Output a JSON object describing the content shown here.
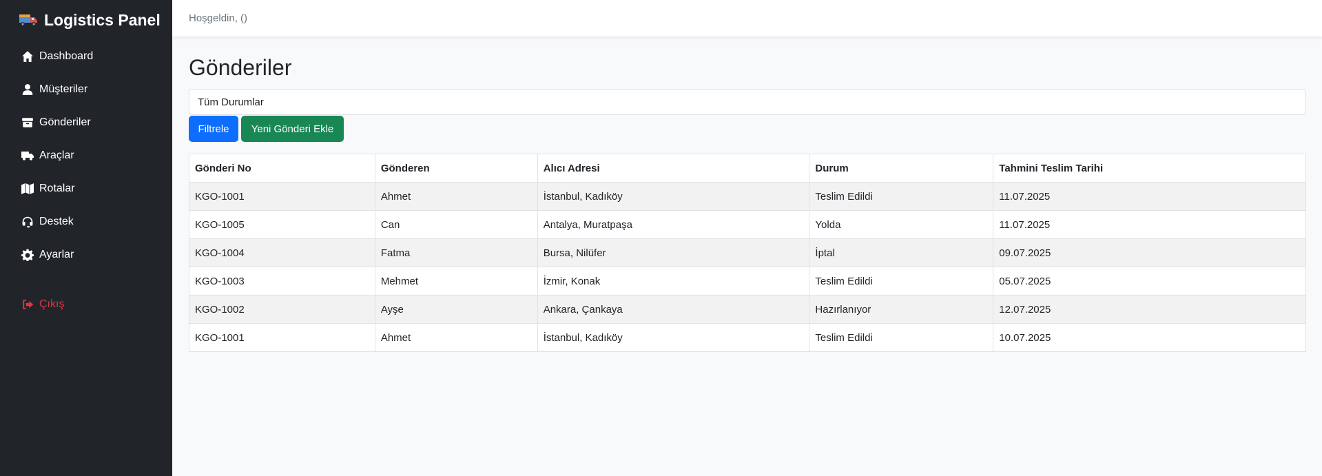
{
  "sidebar": {
    "brand": "Logistics Panel",
    "brand_icon": "truck-icon",
    "items": [
      {
        "label": "Dashboard",
        "icon": "home-icon"
      },
      {
        "label": "Müşteriler",
        "icon": "user-icon"
      },
      {
        "label": "Gönderiler",
        "icon": "box-icon"
      },
      {
        "label": "Araçlar",
        "icon": "truck-icon"
      },
      {
        "label": "Rotalar",
        "icon": "map-icon"
      },
      {
        "label": "Destek",
        "icon": "headset-icon"
      },
      {
        "label": "Ayarlar",
        "icon": "gear-icon"
      }
    ],
    "logout": {
      "label": "Çıkış",
      "icon": "logout-icon",
      "color": "#dc3545"
    }
  },
  "topbar": {
    "greeting": "Hoşgeldin, ()"
  },
  "main": {
    "title": "Gönderiler",
    "filter_select": "Tüm Durumlar",
    "filter_button": "Filtrele",
    "add_button": "Yeni Gönderi Ekle"
  },
  "table": {
    "headers": [
      "Gönderi No",
      "Gönderen",
      "Alıcı Adresi",
      "Durum",
      "Tahmini Teslim Tarihi"
    ],
    "rows": [
      [
        "KGO-1001",
        "Ahmet",
        "İstanbul, Kadıköy",
        "Teslim Edildi",
        "11.07.2025"
      ],
      [
        "KGO-1005",
        "Can",
        "Antalya, Muratpaşa",
        "Yolda",
        "11.07.2025"
      ],
      [
        "KGO-1004",
        "Fatma",
        "Bursa, Nilüfer",
        "İptal",
        "09.07.2025"
      ],
      [
        "KGO-1003",
        "Mehmet",
        "İzmir, Konak",
        "Teslim Edildi",
        "05.07.2025"
      ],
      [
        "KGO-1002",
        "Ayşe",
        "Ankara, Çankaya",
        "Hazırlanıyor",
        "12.07.2025"
      ],
      [
        "KGO-1001",
        "Ahmet",
        "İstanbul, Kadıköy",
        "Teslim Edildi",
        "10.07.2025"
      ]
    ]
  },
  "colors": {
    "sidebar_bg": "#212529",
    "primary": "#0d6efd",
    "success": "#198754",
    "danger": "#dc3545"
  }
}
